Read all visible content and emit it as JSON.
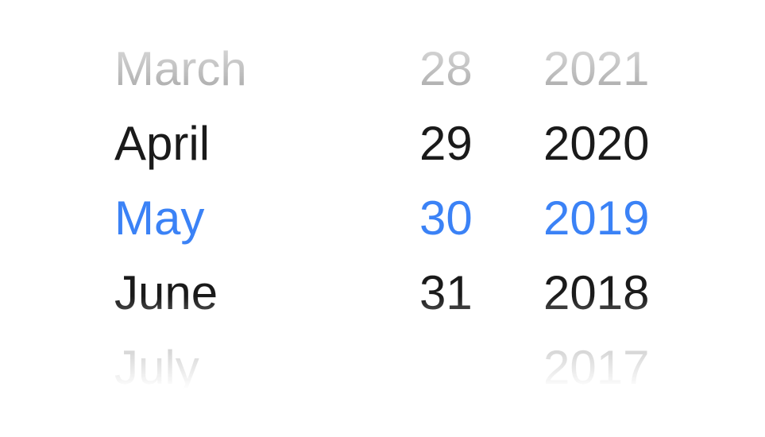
{
  "picker": {
    "accent_color": "#3b82f6",
    "selected": {
      "month": "May",
      "day": "30",
      "year": "2019"
    },
    "months": [
      "March",
      "April",
      "May",
      "June",
      "July"
    ],
    "days": [
      "28",
      "29",
      "30",
      "31",
      ""
    ],
    "years": [
      "2021",
      "2020",
      "2019",
      "2018",
      "2017"
    ]
  }
}
